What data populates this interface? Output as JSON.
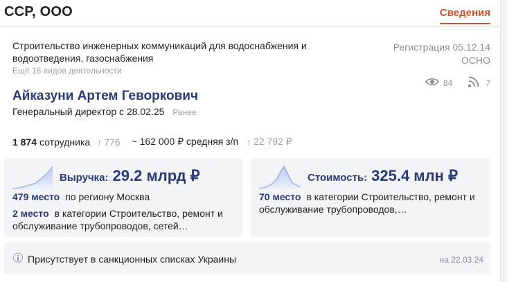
{
  "header": {
    "company": "ССР, ООО",
    "tab": "Сведения"
  },
  "activity": {
    "main": "Строительство инженерных коммуникаций для водоснабжения и водоотведения, газоснабжения",
    "more": "Ещё 16 видов деятельности"
  },
  "registration": {
    "date": "Регистрация 05.12.14",
    "tax": "ОСНО"
  },
  "stats": {
    "views": "84",
    "subscribers": "7"
  },
  "director": {
    "name": "Айказуни Артем Геворкович",
    "position": "Генеральный директор с 28.02.25",
    "earlier": "Ранее"
  },
  "employees": {
    "count": "1 874",
    "label": "сотрудника",
    "change": "776",
    "salary": "~ 162 000 ₽ средняя з/п",
    "salary_ref": "22 792 ₽"
  },
  "revenue": {
    "label": "Выручка:",
    "value": "29.2 млрд ₽",
    "rank1_place": "479 место",
    "rank1_text": "по региону Москва",
    "rank2_place": "2 место",
    "rank2_text": "в категории Строительство, ремонт и обслуживание трубопроводов, сетей…"
  },
  "value": {
    "label": "Стоимость:",
    "amount": "325.4 млн ₽",
    "rank1_place": "70 место",
    "rank1_text": "в категории Строительство, ремонт и обслуживание трубопроводов,…"
  },
  "notice": {
    "text": "Присутствует в санкционных списках Украины",
    "date": "на 22.03.24"
  },
  "colors": {
    "accent": "#d0532c",
    "primary": "#2b3a78",
    "muted": "#9aa0a8"
  },
  "icons": {
    "views": "eye-icon",
    "subscribers": "rss-icon",
    "info": "info-icon",
    "growth": "arrow-up-icon"
  }
}
